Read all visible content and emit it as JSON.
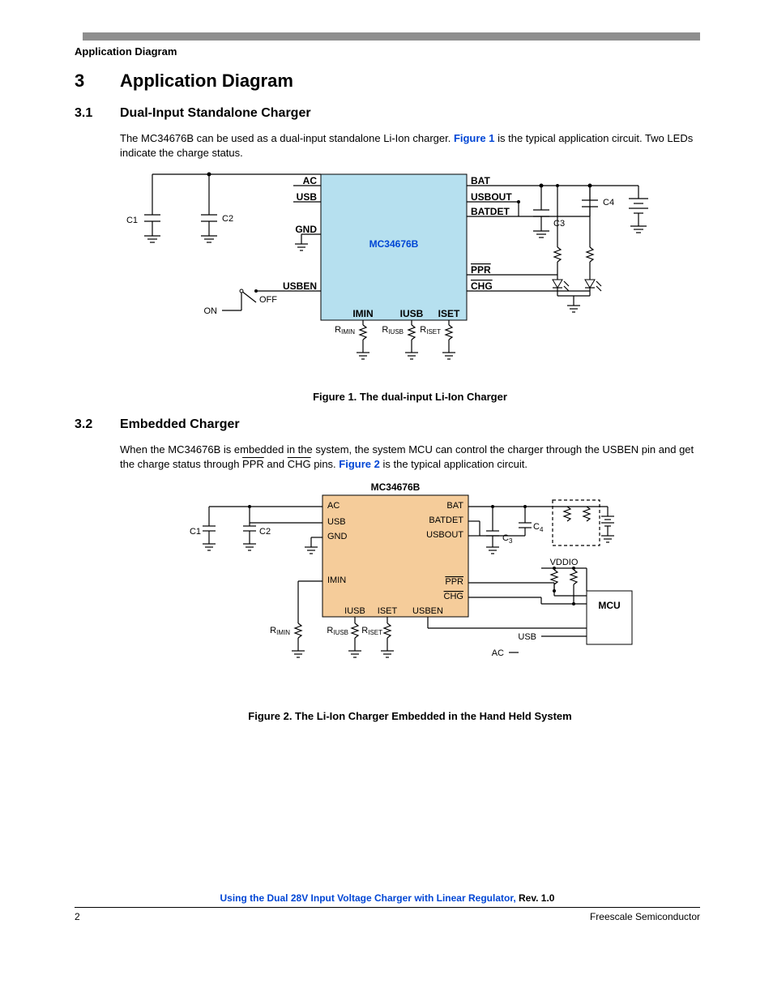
{
  "header": {
    "running": "Application Diagram"
  },
  "sec3": {
    "num": "3",
    "title": "Application Diagram"
  },
  "sec31": {
    "num": "3.1",
    "title": "Dual-Input Standalone Charger",
    "p_a": "The MC34676B can be used as a dual-input standalone Li-Ion charger. ",
    "figref": "Figure 1",
    "p_b": " is the typical application circuit. Two LEDs indicate the charge status."
  },
  "fig1": {
    "caption": "Figure 1. The dual-input Li-Ion Charger",
    "chip": "MC34676B",
    "pins": {
      "ac": "AC",
      "usb": "USB",
      "gnd": "GND",
      "usben": "USBEN",
      "bat": "BAT",
      "usbout": "USBOUT",
      "batdet": "BATDET",
      "ppr": "PPR",
      "chg": "CHG",
      "imin": "IMIN",
      "iusb": "IUSB",
      "iset": "ISET"
    },
    "ext": {
      "on": "ON",
      "off": "OFF",
      "c1": "C1",
      "c2": "C2",
      "c3": "C3",
      "c4": "C4",
      "rimin_pre": "R",
      "rimin_sub": "IMIN",
      "riusb_pre": "R",
      "riusb_sub": "IUSB",
      "riset_pre": "R",
      "riset_sub": "ISET"
    }
  },
  "sec32": {
    "num": "3.2",
    "title": "Embedded Charger",
    "p_a": "When the MC34676B is embedded in the system, the system MCU can control the charger through the USBEN pin and get the charge status through ",
    "ppr": "PPR",
    "and": " and ",
    "chg": "CHG",
    "p_b": " pins. ",
    "figref": "Figure 2",
    "p_c": " is the typical application circuit."
  },
  "fig2": {
    "caption": "Figure 2. The Li-Ion Charger Embedded in the Hand Held System",
    "chip": "MC34676B",
    "pins": {
      "ac": "AC",
      "usb": "USB",
      "gnd": "GND",
      "bat": "BAT",
      "batdet": "BATDET",
      "usbout": "USBOUT",
      "imin": "IMIN",
      "iusb": "IUSB",
      "iset": "ISET",
      "usben": "USBEN",
      "ppr": "PPR",
      "chg": "CHG"
    },
    "ext": {
      "c1": "C1",
      "c2": "C2",
      "c3pre": "C",
      "c3sub": "3",
      "c4pre": "C",
      "c4sub": "4",
      "vddio": "VDDIO",
      "mcu": "MCU",
      "usb": "USB",
      "ac": "AC",
      "rimin_pre": "R",
      "rimin_sub": "IMIN",
      "riusb_pre": "R",
      "riusb_sub": "IUSB",
      "riset_pre": "R",
      "riset_sub": "ISET"
    }
  },
  "footer": {
    "doclink": "Using the Dual 28V Input Voltage Charger with Linear Regulator, ",
    "rev": "Rev. 1.0",
    "page": "2",
    "company": "Freescale Semiconductor"
  }
}
